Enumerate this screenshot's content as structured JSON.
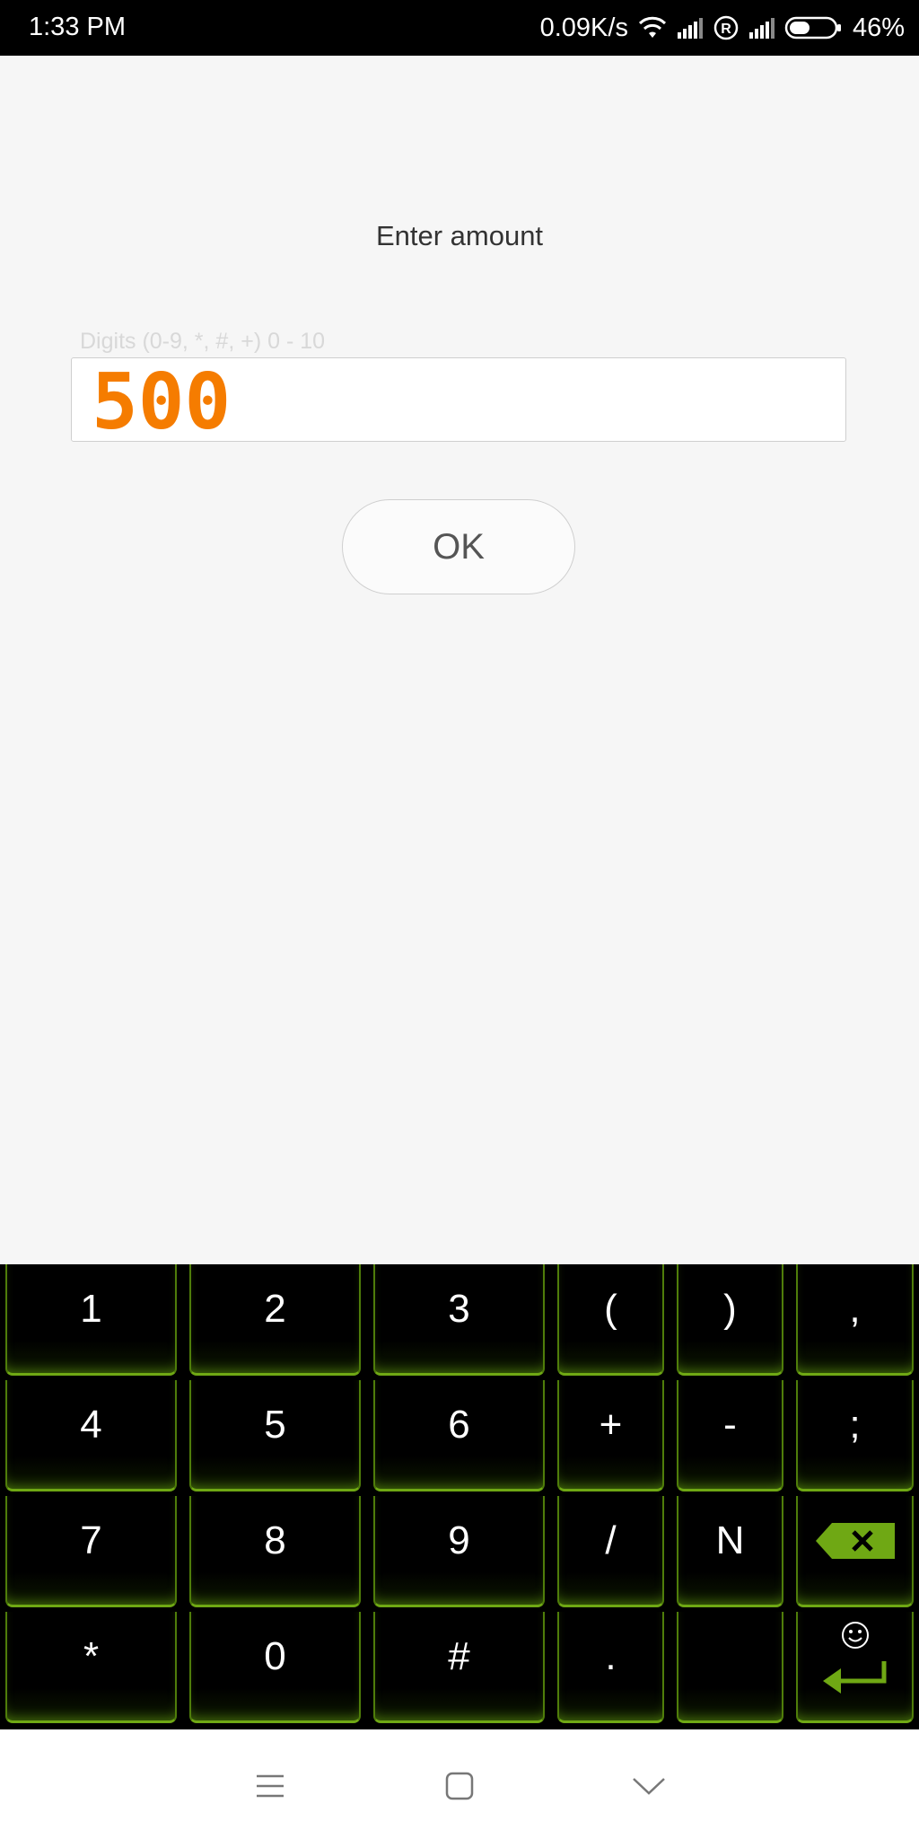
{
  "status_bar": {
    "time": "1:33 PM",
    "network_speed": "0.09K/s",
    "roaming_badge": "R",
    "battery_percent": "46%",
    "battery_level": 0.46,
    "icons": [
      "wifi-icon",
      "signal-icon",
      "roaming-icon",
      "signal-icon",
      "battery-icon"
    ]
  },
  "dialog": {
    "title": "Enter amount",
    "input_hint": "Digits (0-9, *, #, +) 0 - 10",
    "amount_value": "500",
    "ok_label": "OK",
    "accent_color": "#f57c00"
  },
  "keyboard": {
    "accent_color": "#6fa814",
    "rows": [
      [
        "1",
        "2",
        "3",
        "(",
        ")",
        ","
      ],
      [
        "4",
        "5",
        "6",
        "+",
        "-",
        ";"
      ],
      [
        "7",
        "8",
        "9",
        "/",
        "N",
        ""
      ],
      [
        "*",
        "0",
        "#",
        ".",
        "",
        ""
      ]
    ],
    "special_keys": [
      "backspace-icon",
      "emoji-icon",
      "enter-icon"
    ]
  },
  "navbar": {
    "icons": [
      "menu-icon",
      "home-icon",
      "back-icon"
    ]
  }
}
